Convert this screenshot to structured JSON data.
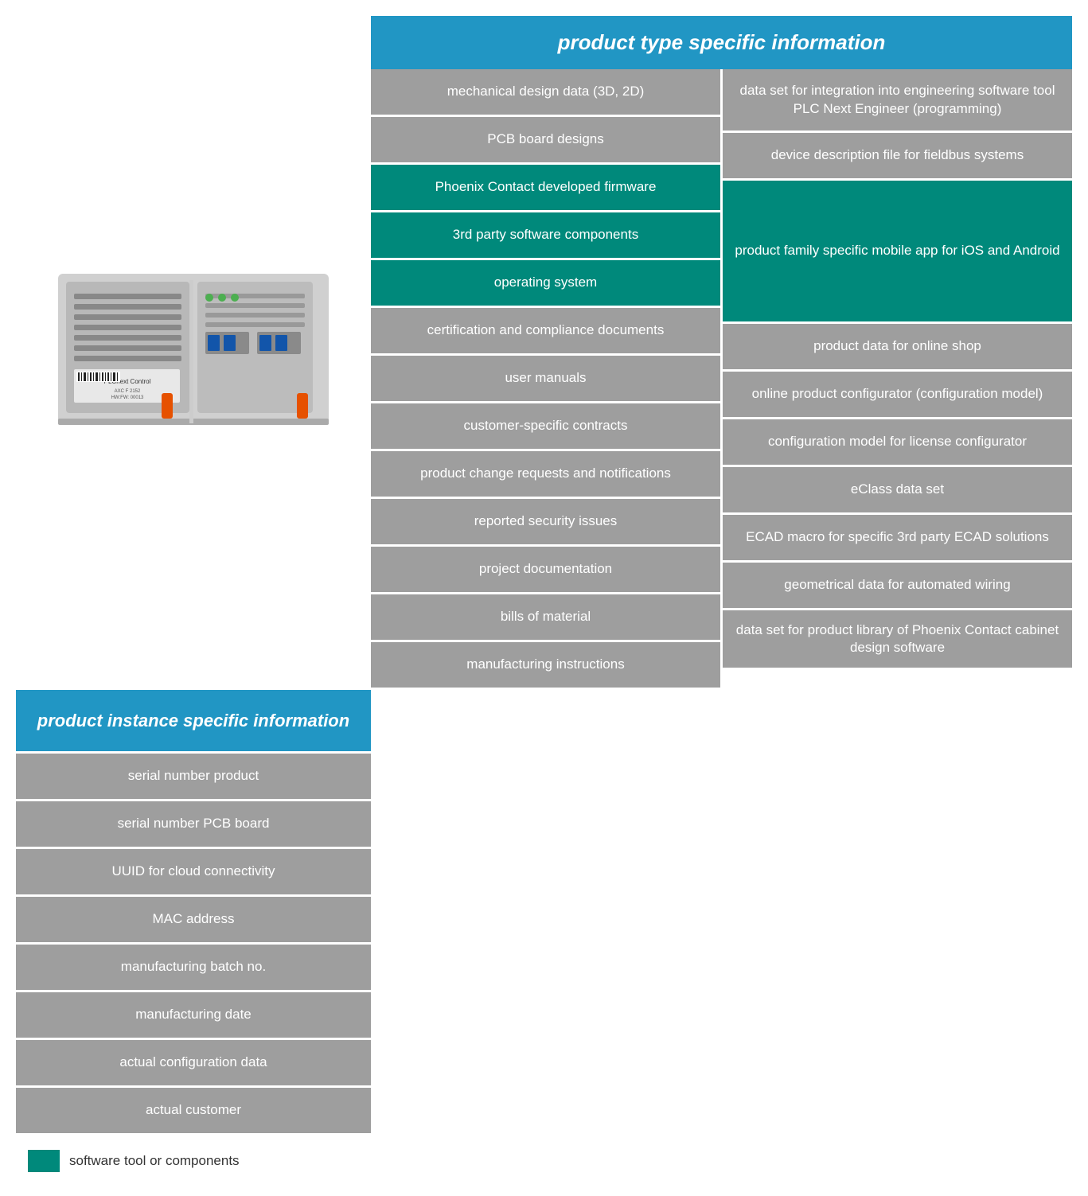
{
  "header": {
    "product_type_label": "product type specific information",
    "product_instance_label": "product instance specific information"
  },
  "col_left": {
    "header": "product instance specific information",
    "items": [
      "serial number product",
      "serial number PCB board",
      "UUID for cloud connectivity",
      "MAC address",
      "manufacturing batch no.",
      "manufacturing date",
      "actual configuration data",
      "actual customer"
    ]
  },
  "col_mid": {
    "items": [
      {
        "text": "mechanical design data (3D, 2D)",
        "type": "gray"
      },
      {
        "text": "PCB board designs",
        "type": "gray"
      },
      {
        "text": "Phoenix Contact developed firmware",
        "type": "teal"
      },
      {
        "text": "3rd party software components",
        "type": "teal"
      },
      {
        "text": "operating system",
        "type": "teal"
      },
      {
        "text": "certification and compliance documents",
        "type": "gray"
      },
      {
        "text": "user manuals",
        "type": "gray"
      },
      {
        "text": "customer-specific contracts",
        "type": "gray"
      },
      {
        "text": "product change requests and notifications",
        "type": "gray"
      },
      {
        "text": "reported security issues",
        "type": "gray"
      },
      {
        "text": "project documentation",
        "type": "gray"
      },
      {
        "text": "bills of material",
        "type": "gray"
      },
      {
        "text": "manufacturing instructions",
        "type": "gray"
      }
    ]
  },
  "col_right": {
    "items": [
      {
        "text": "data set for integration into engineering software tool PLC Next Engineer (programming)",
        "type": "gray"
      },
      {
        "text": "device description file for fieldbus systems",
        "type": "gray"
      },
      {
        "text": "product family specific mobile app for iOS and Android",
        "type": "teal"
      },
      {
        "text": "product data for online shop",
        "type": "gray"
      },
      {
        "text": "online product configurator (configuration model)",
        "type": "gray"
      },
      {
        "text": "configuration model for license configurator",
        "type": "gray"
      },
      {
        "text": "eClass data set",
        "type": "gray"
      },
      {
        "text": "ECAD macro for specific 3rd party ECAD solutions",
        "type": "gray"
      },
      {
        "text": "geometrical data for automated wiring",
        "type": "gray"
      },
      {
        "text": "data set for product library of Phoenix Contact cabinet design software",
        "type": "gray"
      }
    ]
  },
  "legend": {
    "label": "software tool or components"
  }
}
